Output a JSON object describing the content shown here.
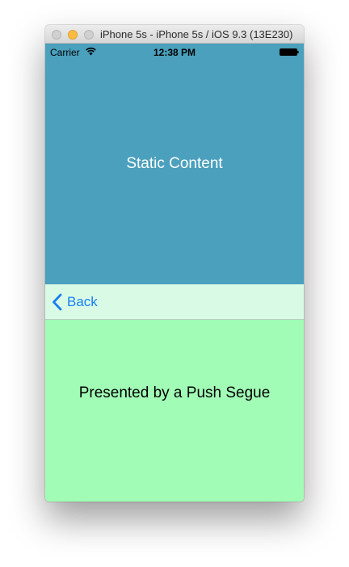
{
  "window": {
    "title": "iPhone 5s - iPhone 5s / iOS 9.3 (13E230)"
  },
  "status_bar": {
    "carrier": "Carrier",
    "time": "12:38 PM",
    "wifi_icon": "wifi-icon",
    "battery_icon": "battery-icon"
  },
  "top_panel": {
    "label": "Static Content",
    "background": "#4aa0bd"
  },
  "nav_bar": {
    "back_label": "Back",
    "back_icon": "chevron-left-icon",
    "tint": "#1a7ef2",
    "background": "#d9fbe6"
  },
  "content": {
    "label": "Presented by a Push Segue",
    "background": "#a1fdb6"
  }
}
